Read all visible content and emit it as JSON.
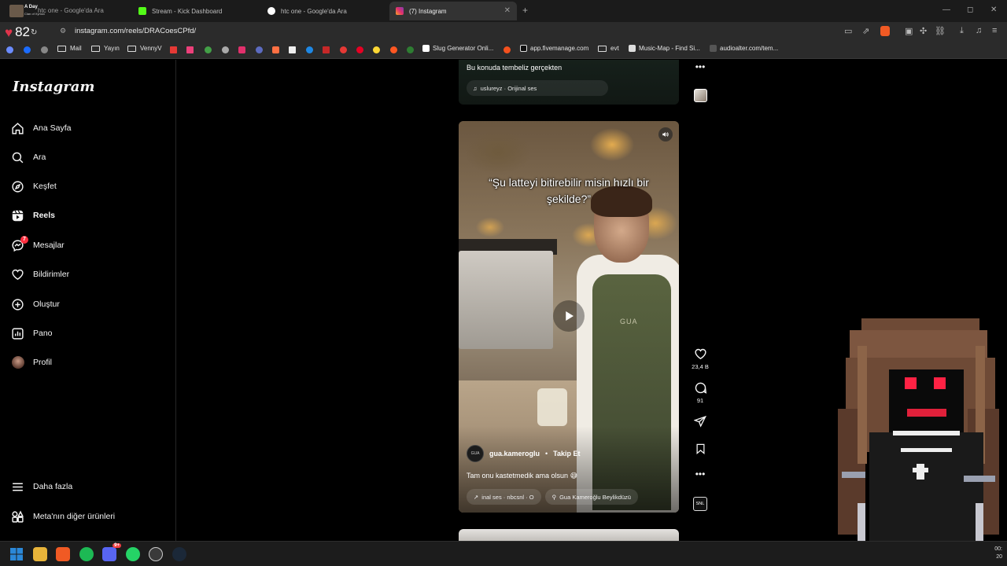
{
  "browser": {
    "tabs": [
      {
        "title": "htc one - Google'da Ara",
        "active": false,
        "favicon": "google-icon"
      },
      {
        "title": "Stream - Kick Dashboard",
        "active": false,
        "favicon": "kick-icon"
      },
      {
        "title": "htc one - Google'da Ara",
        "active": false,
        "favicon": "google-icon"
      },
      {
        "title": "(7) Instagram",
        "active": true,
        "favicon": "instagram-icon"
      }
    ],
    "stream_overlay": {
      "title": "A Day",
      "subtitle": "Clan of Xymox"
    },
    "heart_count": "82",
    "url": "instagram.com/reels/DRACoesCPfd/",
    "bookmarks": [
      {
        "label": "Mail",
        "icon": "folder-icon"
      },
      {
        "label": "Yayın",
        "icon": "folder-icon"
      },
      {
        "label": "VennyV",
        "icon": "folder-icon"
      },
      {
        "label": "Slug Generator Onli...",
        "icon": "slug-icon"
      },
      {
        "label": "app.fivemanage.com",
        "icon": "fivemanage-icon"
      },
      {
        "label": "evt",
        "icon": "folder-icon"
      },
      {
        "label": "Music-Map - Find Si...",
        "icon": "music-map-icon"
      },
      {
        "label": "audioalter.com/tem...",
        "icon": "audioalter-icon"
      }
    ]
  },
  "instagram": {
    "logo": "Instagram",
    "nav": [
      {
        "label": "Ana Sayfa",
        "icon": "home-icon",
        "bold": false
      },
      {
        "label": "Ara",
        "icon": "search-icon",
        "bold": false
      },
      {
        "label": "Keşfet",
        "icon": "compass-icon",
        "bold": false
      },
      {
        "label": "Reels",
        "icon": "reels-icon",
        "bold": true
      },
      {
        "label": "Mesajlar",
        "icon": "messenger-icon",
        "bold": false,
        "badge": "7"
      },
      {
        "label": "Bildirimler",
        "icon": "heart-icon",
        "bold": false
      },
      {
        "label": "Oluştur",
        "icon": "plus-square-icon",
        "bold": false
      },
      {
        "label": "Pano",
        "icon": "dashboard-icon",
        "bold": false
      },
      {
        "label": "Profil",
        "icon": "avatar-icon",
        "bold": false
      }
    ],
    "bottom_nav": [
      {
        "label": "Daha fazla",
        "icon": "menu-icon"
      },
      {
        "label": "Meta'nın diğer ürünleri",
        "icon": "meta-products-icon"
      }
    ],
    "previous_reel": {
      "caption": "Bu konuda tembeliz gerçekten",
      "audio": "uslureyz · Orijinal ses"
    },
    "reel": {
      "overlay_text": "“Şu latteyi bitirebilir misin hızlı bir şekilde?”",
      "apron_text": "GUA",
      "author": "gua.kameroglu",
      "follow_label": "Takip Et",
      "caption": "Tam onu kastetmedik ama olsun 😅",
      "audio_chip": "inal ses · nbcsnl · O",
      "location_chip": "Gua Kameroğlu Beylikdüzü",
      "likes": "23,4 B",
      "comments": "91",
      "audio_tile_label": "SNL"
    }
  },
  "taskbar": {
    "apps": [
      {
        "name": "windows-start",
        "color": "#2b88d8"
      },
      {
        "name": "file-explorer",
        "color": "#e8b43a"
      },
      {
        "name": "brave",
        "color": "#f05a24"
      },
      {
        "name": "spotify",
        "color": "#1db954"
      },
      {
        "name": "discord",
        "color": "#5865f2",
        "badge": "9+"
      },
      {
        "name": "whatsapp",
        "color": "#25d366"
      },
      {
        "name": "obs",
        "color": "#3a3a3a"
      },
      {
        "name": "steam",
        "color": "#1b2838"
      }
    ],
    "clock_time": "00:",
    "clock_date": "20"
  }
}
